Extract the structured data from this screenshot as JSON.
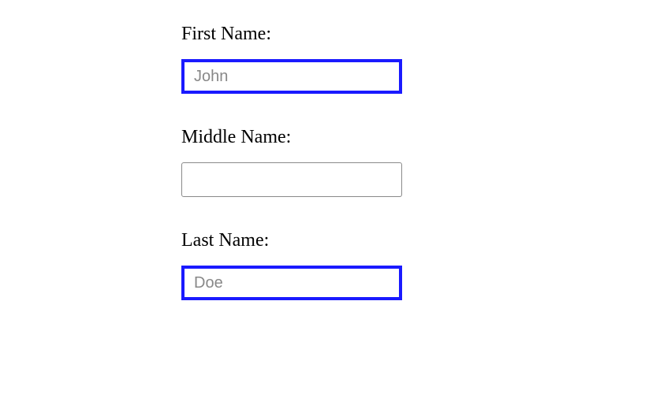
{
  "form": {
    "firstName": {
      "label": "First Name:",
      "placeholder": "John",
      "value": ""
    },
    "middleName": {
      "label": "Middle Name:",
      "placeholder": "",
      "value": ""
    },
    "lastName": {
      "label": "Last Name:",
      "placeholder": "Doe",
      "value": ""
    }
  }
}
